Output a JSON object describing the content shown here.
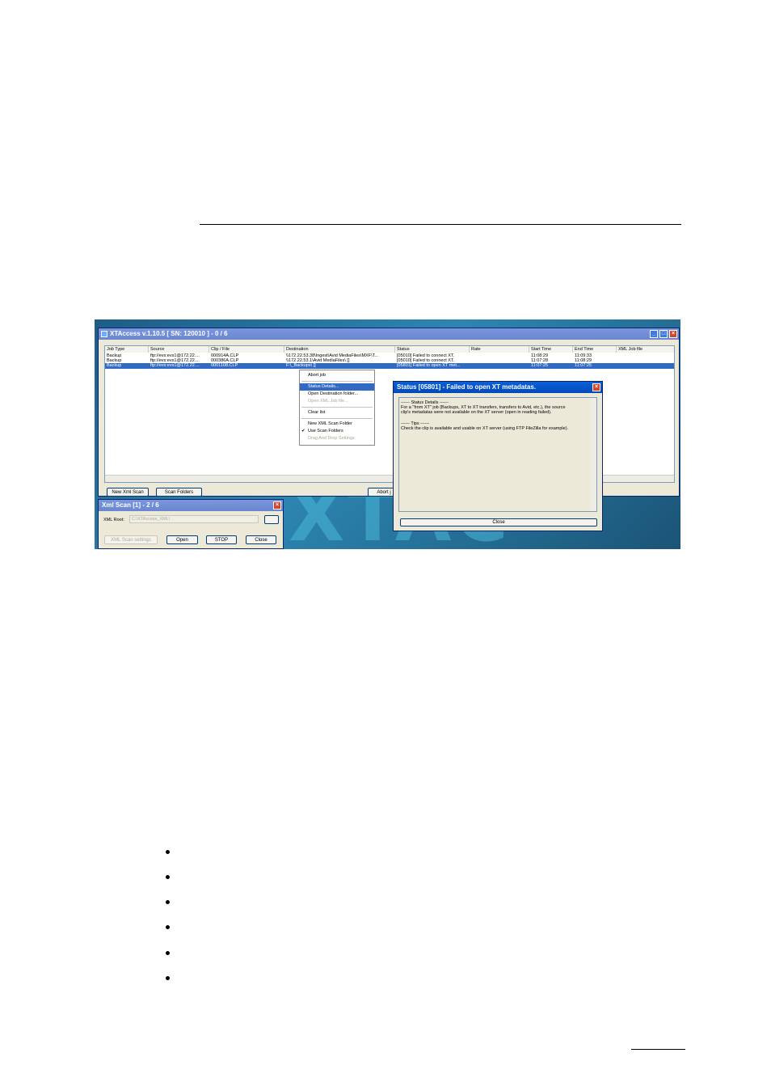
{
  "app": {
    "title": "XTAccess v.1.10.5 [ SN: 120010 ] - 0 / 6",
    "columns": [
      "Job Type",
      "Source",
      "Clip / File",
      "Destination",
      "Status",
      "Rate",
      "Start Time",
      "End Time",
      "XML Job file"
    ],
    "rows": [
      [
        "Backup",
        "ftp://evs:evs1@172.22....",
        "000914A.CLP",
        "\\\\172.22.53.38\\Ingest\\Avid MediaFiles\\MXF\\T...",
        "[05010] Failed to connect XT.",
        "",
        "11:08:29",
        "11:09:33",
        ""
      ],
      [
        "Backup",
        "ftp://evs:evs1@172.22....",
        "000386A.CLP",
        "\\\\172.22.53.1\\Avid MediaFiles\\ []",
        "[05010] Failed to connect XT.",
        "",
        "11:07:28",
        "11:08:29",
        ""
      ],
      [
        "Backup",
        "ftp://evs:evs1@172.22....",
        "0001108.CLP",
        "F:\\_Backups\\ []",
        "[05801] Failed to open XT met...",
        "",
        "11:07:25",
        "11:07:25",
        ""
      ]
    ],
    "buttons": {
      "new_xml_scan": "New Xml Scan",
      "scan_folders": "Scan Folders",
      "abort": "Abort j"
    }
  },
  "context_menu": {
    "items": [
      {
        "label": "Abort job"
      },
      {
        "label": "Status Details..."
      },
      {
        "label": "Open Destination folder..."
      },
      {
        "label": "Open XML Job file..."
      },
      {
        "label": "Clear list"
      },
      {
        "label": "New XML Scan Folder"
      },
      {
        "label": "Use Scan Folders"
      },
      {
        "label": "Drag And Drop Settings"
      }
    ]
  },
  "status_dialog": {
    "title": "Status [05801] - Failed to open XT metadatas.",
    "line1": "------ Status Details ------",
    "line2": "For a \"from XT\" job (Backups, XT to XT transfers, transfers to Avid, etc.), the source",
    "line3": "clip's metadatas were not available on the XT server (open in reading failed).",
    "line4": "------ Tips ------",
    "line5": "Check the clip is available and usable on XT server  (using FTP FileZilla for example).",
    "close": "Close"
  },
  "xml_scan": {
    "title": "Xml Scan [1] - 2 / 6",
    "root_label": "XML Root:",
    "root_value": "C:\\XTAccess_XML\\",
    "settings": "XML Scan settings",
    "open": "Open",
    "stop": "STOP",
    "close": "Close"
  }
}
